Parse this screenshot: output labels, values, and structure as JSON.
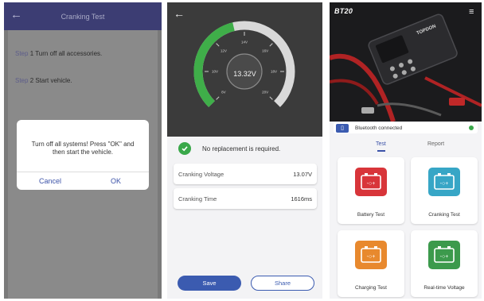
{
  "screen1": {
    "title": "Cranking Test",
    "step1_word": "Step",
    "step1_text": " 1 Turn off all accessories.",
    "step2_word": "Step",
    "step2_text": " 2 Start vehicle.",
    "dialog_message": "Turn off all systems! Press \"OK\" and then start the vehicle.",
    "cancel_label": "Cancel",
    "ok_label": "OK"
  },
  "screen2": {
    "gauge_value": "13.32V",
    "gauge_ticks": [
      "8V",
      "10V",
      "12V",
      "14V",
      "16V",
      "18V",
      "20V"
    ],
    "gauge_fill_fraction": 0.45,
    "status_text": "No replacement is required.",
    "rows": [
      {
        "label": "Cranking Voltage",
        "value": "13.07V"
      },
      {
        "label": "Cranking Time",
        "value": "1616ms"
      }
    ],
    "save_label": "Save",
    "share_label": "Share",
    "colors": {
      "gauge_green": "#3fae49",
      "accent": "#3b5bb0"
    }
  },
  "screen3": {
    "brand": "BT20",
    "device_brand": "TOPDON",
    "bluetooth_text": "Bluetooth connected",
    "tabs": [
      "Test",
      "Report"
    ],
    "tiles": [
      {
        "label": "Battery Test",
        "icon": "battery-red-icon",
        "color": "#d8353a"
      },
      {
        "label": "Cranking Test",
        "icon": "battery-teal-icon",
        "color": "#37a6c6"
      },
      {
        "label": "Charging Test",
        "icon": "battery-orange-icon",
        "color": "#e8892e"
      },
      {
        "label": "Real-time Voltage",
        "icon": "battery-green-icon",
        "color": "#3c9a4c"
      }
    ]
  }
}
